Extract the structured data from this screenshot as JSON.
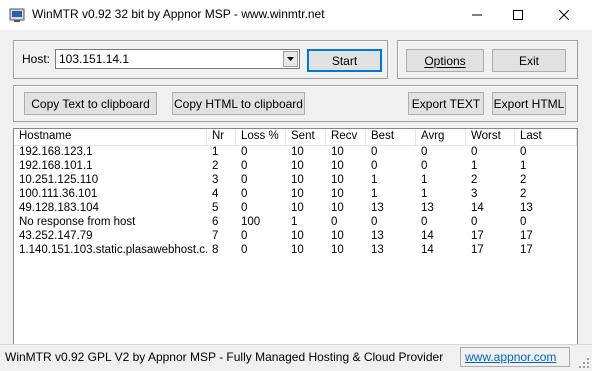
{
  "window": {
    "title": "WinMTR v0.92 32 bit by Appnor MSP - www.winmtr.net"
  },
  "host": {
    "label": "Host:",
    "value": "103.151.14.1",
    "start_label": "Start"
  },
  "actions": {
    "options_label": "Options",
    "exit_label": "Exit",
    "copy_text_label": "Copy Text to clipboard",
    "copy_html_label": "Copy HTML to clipboard",
    "export_text_label": "Export TEXT",
    "export_html_label": "Export HTML"
  },
  "table": {
    "columns": [
      "Hostname",
      "Nr",
      "Loss %",
      "Sent",
      "Recv",
      "Best",
      "Avrg",
      "Worst",
      "Last"
    ],
    "rows": [
      [
        "192.168.123.1",
        "1",
        "0",
        "10",
        "10",
        "0",
        "0",
        "0",
        "0"
      ],
      [
        "192.168.101.1",
        "2",
        "0",
        "10",
        "10",
        "0",
        "0",
        "1",
        "1"
      ],
      [
        "10.251.125.110",
        "3",
        "0",
        "10",
        "10",
        "1",
        "1",
        "2",
        "2"
      ],
      [
        "100.111.36.101",
        "4",
        "0",
        "10",
        "10",
        "1",
        "1",
        "3",
        "2"
      ],
      [
        "49.128.183.104",
        "5",
        "0",
        "10",
        "10",
        "13",
        "13",
        "14",
        "13"
      ],
      [
        "No response from host",
        "6",
        "100",
        "1",
        "0",
        "0",
        "0",
        "0",
        "0"
      ],
      [
        "43.252.147.79",
        "7",
        "0",
        "10",
        "10",
        "13",
        "14",
        "17",
        "17"
      ],
      [
        "1.140.151.103.static.plasawebhost.c...",
        "8",
        "0",
        "10",
        "10",
        "13",
        "14",
        "17",
        "17"
      ]
    ]
  },
  "status": {
    "text": "WinMTR v0.92 GPL V2 by Appnor MSP - Fully Managed Hosting & Cloud Provider",
    "link": "www.appnor.com"
  },
  "colors": {
    "link": "#0066cc",
    "button_face": "#e1e1e1",
    "focus_border": "#0078d7"
  }
}
